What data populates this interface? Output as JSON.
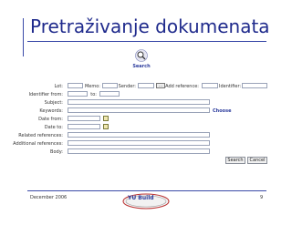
{
  "slide": {
    "title": "Pretraživanje dokumenata"
  },
  "toolbar": {
    "search_label": "Search"
  },
  "form": {
    "fields": {
      "lot": "Lot:",
      "memo": "Memo:",
      "sender": "Sender:",
      "add_reference": "Add reference:",
      "identifier": "Identifier:",
      "identifier_from": "Identifier from:",
      "to": "to:",
      "subject": "Subject:",
      "keywords": "Keywords:",
      "date_from": "Date from:",
      "date_to": "Date to:",
      "related_references": "Related references:",
      "additional_references": "Additional references:",
      "body": "Body:"
    },
    "sender_lookup": "...",
    "choose_link": "Choose",
    "search_button": "Search",
    "cancel_button": "Cancel"
  },
  "footer": {
    "date": "December 2006",
    "logo_text": "YU Build",
    "page_number": "9"
  },
  "colors": {
    "title": "#1f2a8c",
    "rule": "#3a4aa8",
    "link": "#2a3a9c"
  }
}
